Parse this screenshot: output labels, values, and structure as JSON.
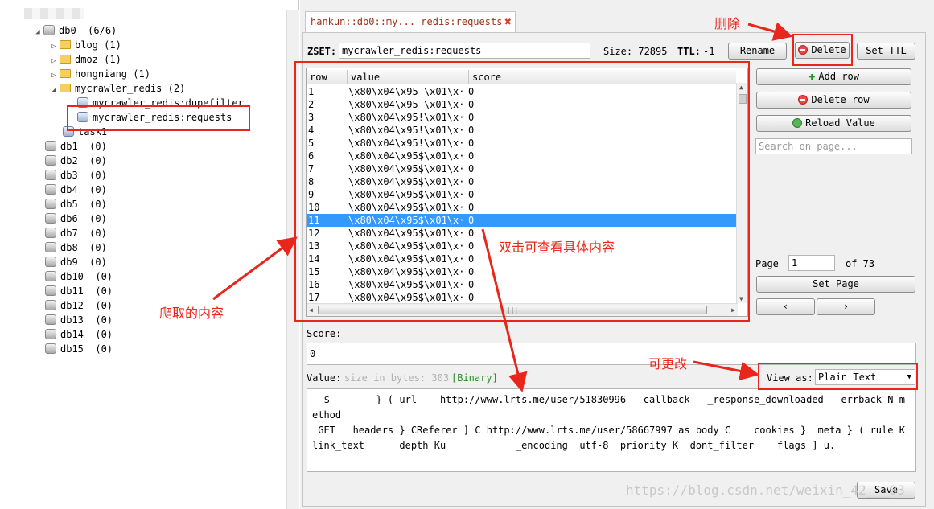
{
  "tree": {
    "blur_text": "",
    "db0": {
      "label": "db0",
      "count": "(6/6)"
    },
    "children": [
      {
        "label": "blog",
        "count": "(1)"
      },
      {
        "label": "dmoz",
        "count": "(1)"
      },
      {
        "label": "hongniang",
        "count": "(1)"
      },
      {
        "label": "mycrawler_redis",
        "count": "(2)"
      }
    ],
    "subkeys": [
      "mycrawler_redis:dupefilter",
      "mycrawler_redis:requests"
    ],
    "task_label": "task1",
    "dbs": [
      {
        "label": "db1",
        "count": "(0)"
      },
      {
        "label": "db2",
        "count": "(0)"
      },
      {
        "label": "db3",
        "count": "(0)"
      },
      {
        "label": "db4",
        "count": "(0)"
      },
      {
        "label": "db5",
        "count": "(0)"
      },
      {
        "label": "db6",
        "count": "(0)"
      },
      {
        "label": "db7",
        "count": "(0)"
      },
      {
        "label": "db8",
        "count": "(0)"
      },
      {
        "label": "db9",
        "count": "(0)"
      },
      {
        "label": "db10",
        "count": "(0)"
      },
      {
        "label": "db11",
        "count": "(0)"
      },
      {
        "label": "db12",
        "count": "(0)"
      },
      {
        "label": "db13",
        "count": "(0)"
      },
      {
        "label": "db14",
        "count": "(0)"
      },
      {
        "label": "db15",
        "count": "(0)"
      }
    ]
  },
  "tab": {
    "title": "hankun::db0::my..._redis:requests",
    "close": "✖"
  },
  "key": {
    "type_label": "ZSET:",
    "name": "mycrawler_redis:requests",
    "size_label": "Size: 72895",
    "ttl_label": "TTL:",
    "ttl_value": "-1",
    "rename": "Rename",
    "delete": "Delete",
    "set_ttl": "Set TTL"
  },
  "table": {
    "columns": [
      "row",
      "value",
      "score"
    ],
    "rows": [
      {
        "row": "1",
        "value": "\\x80\\x04\\x95 \\x01\\x···",
        "score": "0"
      },
      {
        "row": "2",
        "value": "\\x80\\x04\\x95 \\x01\\x···",
        "score": "0"
      },
      {
        "row": "3",
        "value": "\\x80\\x04\\x95!\\x01\\x···",
        "score": "0"
      },
      {
        "row": "4",
        "value": "\\x80\\x04\\x95!\\x01\\x···",
        "score": "0"
      },
      {
        "row": "5",
        "value": "\\x80\\x04\\x95!\\x01\\x···",
        "score": "0"
      },
      {
        "row": "6",
        "value": "\\x80\\x04\\x95$\\x01\\x···",
        "score": "0"
      },
      {
        "row": "7",
        "value": "\\x80\\x04\\x95$\\x01\\x···",
        "score": "0"
      },
      {
        "row": "8",
        "value": "\\x80\\x04\\x95$\\x01\\x···",
        "score": "0"
      },
      {
        "row": "9",
        "value": "\\x80\\x04\\x95$\\x01\\x···",
        "score": "0"
      },
      {
        "row": "10",
        "value": "\\x80\\x04\\x95$\\x01\\x···",
        "score": "0"
      },
      {
        "row": "11",
        "value": "\\x80\\x04\\x95$\\x01\\x···",
        "score": "0"
      },
      {
        "row": "12",
        "value": "\\x80\\x04\\x95$\\x01\\x···",
        "score": "0"
      },
      {
        "row": "13",
        "value": "\\x80\\x04\\x95$\\x01\\x···",
        "score": "0"
      },
      {
        "row": "14",
        "value": "\\x80\\x04\\x95$\\x01\\x···",
        "score": "0"
      },
      {
        "row": "15",
        "value": "\\x80\\x04\\x95$\\x01\\x···",
        "score": "0"
      },
      {
        "row": "16",
        "value": "\\x80\\x04\\x95$\\x01\\x···",
        "score": "0"
      },
      {
        "row": "17",
        "value": "\\x80\\x04\\x95$\\x01\\x···",
        "score": "0"
      }
    ],
    "selected_row": "11",
    "hscroll_grip": "|||"
  },
  "side": {
    "add_row": "Add row",
    "delete_row": "Delete row",
    "reload_value": "Reload Value",
    "search_placeholder": "Search on page...",
    "page_label": "Page",
    "page_value": "1",
    "of_label": "of 73",
    "set_page": "Set Page",
    "prev_glyph": "‹",
    "next_glyph": "›"
  },
  "detail": {
    "score_label": "Score:",
    "score_value": "0",
    "value_label": "Value:",
    "size_hint": "size in bytes: 303",
    "binary_tag": "[Binary]",
    "view_as_label": "View as:",
    "view_as_value": "Plain Text",
    "value_text": "  $        } ( url    http://www.lrts.me/user/51830996   callback   _response_downloaded   errback N method\n GET   headers } CReferer ] C http://www.lrts.me/user/58667997 as body C    cookies }  meta } ( rule K\nlink_text      depth Ku            _encoding  utf-8  priority K  dont_filter    flags ] u.",
    "save": "Save"
  },
  "annotations": {
    "delete_note": "删除",
    "dblclick_note": "双击可查看具体内容",
    "crawled_note": "爬取的内容",
    "changeable_note": "可更改",
    "color": "#e8261c"
  },
  "watermark": "https://blog.csdn.net/weixin_42___03"
}
